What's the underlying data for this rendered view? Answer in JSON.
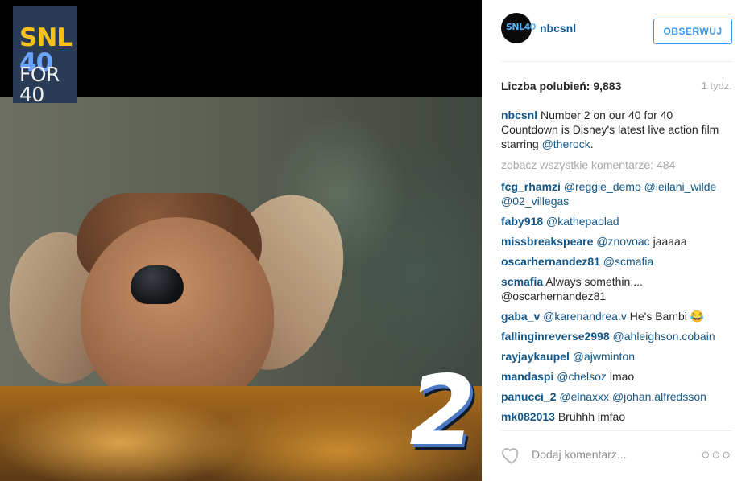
{
  "media": {
    "badge_line1_a": "SNL",
    "badge_line1_b": "40",
    "badge_line2": "FOR 40",
    "rank_number": "2"
  },
  "post": {
    "avatar_label": "SNL40",
    "username": "nbcsnl",
    "follow_label": "OBSERWUJ",
    "likes_label": "Liczba polubień: 9,883",
    "time_ago": "1 tydz.",
    "caption": {
      "user": "nbcsnl",
      "text": "Number 2 on our 40 for 40 Countdown is Disney's latest live action film starring",
      "mention": "@therock",
      "suffix": "."
    },
    "view_all": "zobacz wszystkie komentarze: 484",
    "comments": [
      {
        "user": "fcg_rhamzi",
        "mention": "@reggie_demo @leilani_wilde @02_villegas",
        "text": ""
      },
      {
        "user": "faby918",
        "mention": "@kathepaolad",
        "text": ""
      },
      {
        "user": "missbreakspeare",
        "mention": "@znovoac",
        "text": "jaaaaa"
      },
      {
        "user": "oscarhernandez81",
        "mention": "@scmafia",
        "text": ""
      },
      {
        "user": "scmafia",
        "mention": "",
        "text": "Always somethin.... @oscarhernandez81"
      },
      {
        "user": "gaba_v",
        "mention": "@karenandrea.v",
        "text": "He's Bambi 😂"
      },
      {
        "user": "fallinginreverse2998",
        "mention": "@ahleighson.cobain",
        "text": ""
      },
      {
        "user": "rayjaykaupel",
        "mention": "@ajwminton",
        "text": ""
      },
      {
        "user": "mandaspi",
        "mention": "@chelsoz",
        "text": "lmao"
      },
      {
        "user": "panucci_2",
        "mention": "@elnaxxx @johan.alfredsson",
        "text": ""
      },
      {
        "user": "mk082013",
        "mention": "",
        "text": "Bruhhh lmfao"
      }
    ],
    "add_comment_placeholder": "Dodaj komentarz...",
    "more_label": "○○○"
  },
  "icons": {
    "like": "heart-outline-icon",
    "more": "more-options-icon"
  },
  "colors": {
    "link": "#125688",
    "follow": "#3897f0",
    "muted": "#a5a7aa"
  }
}
